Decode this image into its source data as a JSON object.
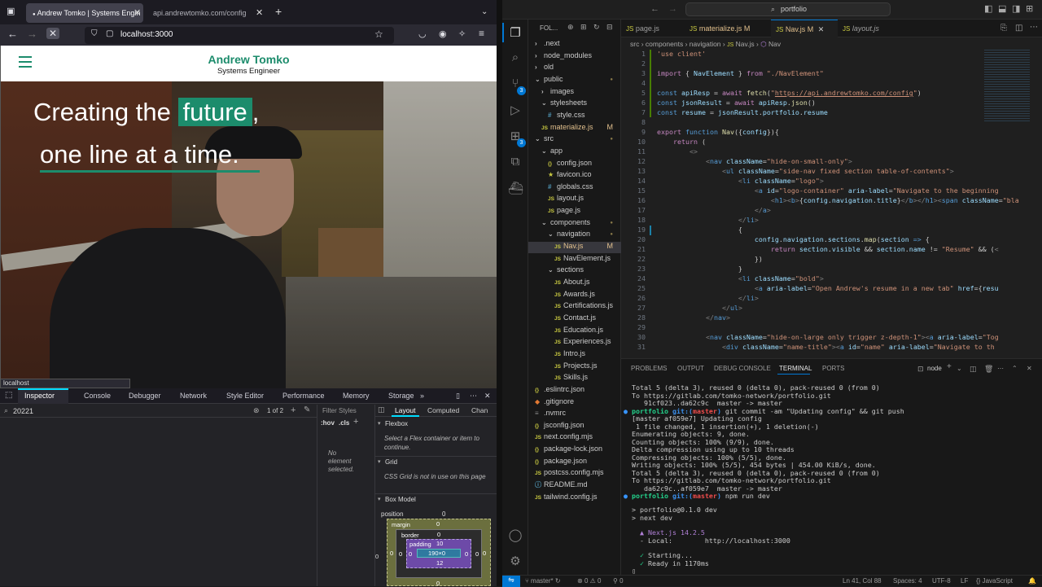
{
  "browser": {
    "tabs": [
      {
        "label": "Andrew Tomko | Systems Engin",
        "active": true
      },
      {
        "label": "api.andrewtomko.com/config",
        "active": false
      }
    ],
    "url": "localhost:3000",
    "tooltip": "localhost"
  },
  "site": {
    "name": "Andrew Tomko",
    "subtitle": "Systems Engineer",
    "hero_line1_a": "Creating the",
    "hero_highlight": "future",
    "hero_line1_b": ",",
    "hero_line2": "one line at a time.",
    "accent": "#1c8c6c"
  },
  "devtools": {
    "tabs": [
      "Inspector",
      "Console",
      "Debugger",
      "Network",
      "Style Editor",
      "Performance",
      "Memory",
      "Storage"
    ],
    "search_value": "20221",
    "search_count": "1 of 2",
    "filter_placeholder": "Filter Styles",
    "hov": ":hov",
    "cls": ".cls",
    "right_tabs": [
      "Layout",
      "Computed",
      "Chan"
    ],
    "flexbox_title": "Flexbox",
    "flexbox_msg": "Select a Flex container or item to continue.",
    "grid_title": "Grid",
    "grid_msg": "CSS Grid is not in use on this page",
    "no_element": "No element selected.",
    "boxmodel_title": "Box Model",
    "position_label": "position",
    "position_val": "0",
    "margin_label": "margin",
    "border_label": "border",
    "padding_label": "padding",
    "content_size": "190×0",
    "padding_top": "10",
    "padding_bottom": "12",
    "zero": "0"
  },
  "vscode": {
    "search": "portfolio",
    "explorer_title": "FOL...",
    "tree": [
      {
        "name": ".next",
        "indent": 0,
        "type": "folder-closed"
      },
      {
        "name": "node_modules",
        "indent": 0,
        "type": "folder-closed"
      },
      {
        "name": "old",
        "indent": 0,
        "type": "folder-closed"
      },
      {
        "name": "public",
        "indent": 0,
        "type": "folder-open",
        "dot": true
      },
      {
        "name": "images",
        "indent": 1,
        "type": "folder-closed"
      },
      {
        "name": "stylesheets",
        "indent": 1,
        "type": "folder-open"
      },
      {
        "name": "style.css",
        "indent": 2,
        "type": "css"
      },
      {
        "name": "materialize.js",
        "indent": 1,
        "type": "js",
        "badge": "M"
      },
      {
        "name": "src",
        "indent": 0,
        "type": "folder-open",
        "dot": true
      },
      {
        "name": "app",
        "indent": 1,
        "type": "folder-open"
      },
      {
        "name": "config.json",
        "indent": 2,
        "type": "json"
      },
      {
        "name": "favicon.ico",
        "indent": 2,
        "type": "ico"
      },
      {
        "name": "globals.css",
        "indent": 2,
        "type": "css"
      },
      {
        "name": "layout.js",
        "indent": 2,
        "type": "js"
      },
      {
        "name": "page.js",
        "indent": 2,
        "type": "js"
      },
      {
        "name": "components",
        "indent": 1,
        "type": "folder-open",
        "dot": true
      },
      {
        "name": "navigation",
        "indent": 2,
        "type": "folder-open",
        "dot": true
      },
      {
        "name": "Nav.js",
        "indent": 3,
        "type": "js",
        "badge": "M",
        "selected": true
      },
      {
        "name": "NavElement.js",
        "indent": 3,
        "type": "js"
      },
      {
        "name": "sections",
        "indent": 2,
        "type": "folder-open"
      },
      {
        "name": "About.js",
        "indent": 3,
        "type": "js"
      },
      {
        "name": "Awards.js",
        "indent": 3,
        "type": "js"
      },
      {
        "name": "Certifications.js",
        "indent": 3,
        "type": "js"
      },
      {
        "name": "Contact.js",
        "indent": 3,
        "type": "js"
      },
      {
        "name": "Education.js",
        "indent": 3,
        "type": "js"
      },
      {
        "name": "Experiences.js",
        "indent": 3,
        "type": "js"
      },
      {
        "name": "Intro.js",
        "indent": 3,
        "type": "js"
      },
      {
        "name": "Projects.js",
        "indent": 3,
        "type": "js"
      },
      {
        "name": "Skills.js",
        "indent": 3,
        "type": "js"
      },
      {
        "name": ".eslintrc.json",
        "indent": 0,
        "type": "json"
      },
      {
        "name": ".gitignore",
        "indent": 0,
        "type": "git"
      },
      {
        "name": ".nvmrc",
        "indent": 0,
        "type": "txt"
      },
      {
        "name": "jsconfig.json",
        "indent": 0,
        "type": "json"
      },
      {
        "name": "next.config.mjs",
        "indent": 0,
        "type": "js"
      },
      {
        "name": "package-lock.json",
        "indent": 0,
        "type": "json"
      },
      {
        "name": "package.json",
        "indent": 0,
        "type": "json"
      },
      {
        "name": "postcss.config.mjs",
        "indent": 0,
        "type": "js"
      },
      {
        "name": "README.md",
        "indent": 0,
        "type": "md"
      },
      {
        "name": "tailwind.config.js",
        "indent": 0,
        "type": "js"
      }
    ],
    "editor_tabs": [
      {
        "label": "page.js",
        "badge": ""
      },
      {
        "label": "materialize.js",
        "badge": "M"
      },
      {
        "label": "Nav.js",
        "badge": "M",
        "active": true
      },
      {
        "label": "layout.js",
        "badge": ""
      }
    ],
    "breadcrumb": [
      "src",
      "components",
      "navigation",
      "Nav.js",
      "Nav"
    ],
    "panel_tabs": [
      "PROBLEMS",
      "OUTPUT",
      "DEBUG CONSOLE",
      "TERMINAL",
      "PORTS"
    ],
    "terminal_name": "node",
    "status": {
      "branch": "master*",
      "errors": "0",
      "warnings": "0",
      "ports": "0",
      "position": "Ln 41, Col 88",
      "spaces": "Spaces: 4",
      "encoding": "UTF-8",
      "eol": "LF",
      "language": "JavaScript"
    }
  }
}
